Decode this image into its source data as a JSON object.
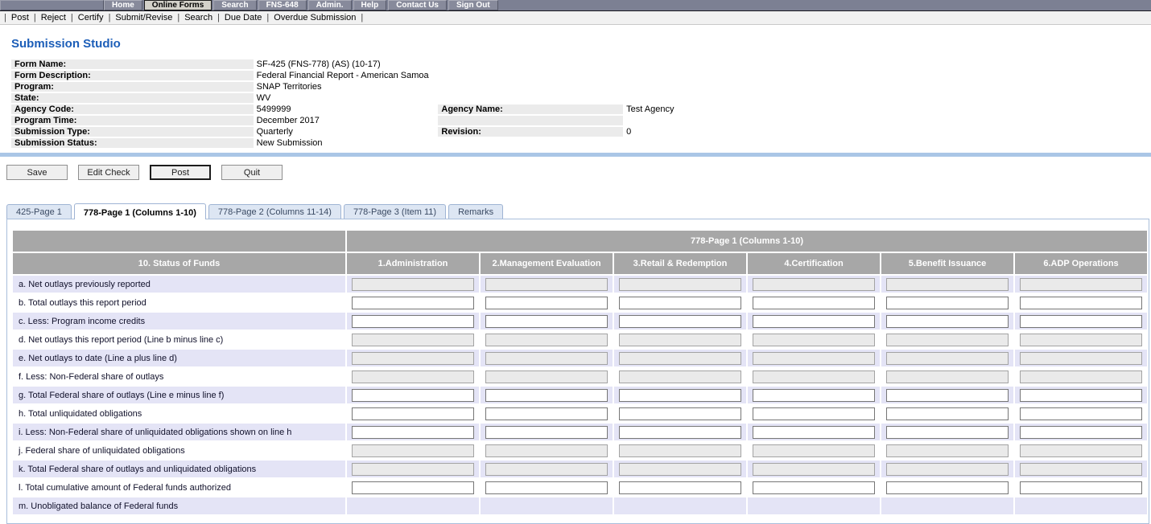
{
  "topnav": {
    "items": [
      {
        "label": "Home",
        "active": false
      },
      {
        "label": "Online Forms",
        "active": true
      },
      {
        "label": "Search",
        "active": false
      },
      {
        "label": "FNS-648",
        "active": false
      },
      {
        "label": "Admin.",
        "active": false
      },
      {
        "label": "Help",
        "active": false
      },
      {
        "label": "Contact Us",
        "active": false
      },
      {
        "label": "Sign Out",
        "active": false
      }
    ]
  },
  "actionbar": {
    "items": [
      "Post",
      "Reject",
      "Certify",
      "Submit/Revise",
      "Search",
      "Due Date",
      "Overdue Submission"
    ],
    "separator": "|"
  },
  "page_title": "Submission Studio",
  "details": {
    "rows": [
      {
        "label": "Form Name:",
        "value": "SF-425 (FNS-778) (AS) (10-17)"
      },
      {
        "label": "Form Description:",
        "value": "Federal Financial Report - American Samoa"
      },
      {
        "label": "Program:",
        "value": "SNAP Territories"
      },
      {
        "label": "State:",
        "value": "WV"
      },
      {
        "label": "Agency Code:",
        "value": "5499999",
        "label2": "Agency Name:",
        "value2": "Test Agency"
      },
      {
        "label": "Program Time:",
        "value": "December 2017",
        "label2": "",
        "value2": ""
      },
      {
        "label": "Submission Type:",
        "value": "Quarterly",
        "label2": "Revision:",
        "value2": "0"
      },
      {
        "label": "Submission Status:",
        "value": "New Submission"
      }
    ]
  },
  "toolbar": {
    "buttons": [
      {
        "label": "Save",
        "default": false
      },
      {
        "label": "Edit Check",
        "default": false
      },
      {
        "label": "Post",
        "default": true
      },
      {
        "label": "Quit",
        "default": false
      }
    ]
  },
  "tabs": [
    {
      "label": "425-Page 1",
      "active": false
    },
    {
      "label": "778-Page 1 (Columns 1-10)",
      "active": true
    },
    {
      "label": "778-Page 2 (Columns 11-14)",
      "active": false
    },
    {
      "label": "778-Page 3 (Item 11)",
      "active": false
    },
    {
      "label": "Remarks",
      "active": false
    }
  ],
  "grid": {
    "group_title": "778-Page 1 (Columns 1-10)",
    "row_header": "10. Status of Funds",
    "columns": [
      "1.Administration",
      "2.Management Evaluation",
      "3.Retail & Redemption",
      "4.Certification",
      "5.Benefit Issuance",
      "6.ADP Operations"
    ],
    "input_value": "",
    "rows": [
      {
        "label": "a. Net outlays previously reported",
        "inputs": "disabled"
      },
      {
        "label": "b. Total outlays this report period",
        "inputs": "enabled"
      },
      {
        "label": "c. Less: Program income credits",
        "inputs": "enabled"
      },
      {
        "label": "d. Net outlays this report period (Line b minus line c)",
        "inputs": "disabled"
      },
      {
        "label": "e. Net outlays to date (Line a plus line d)",
        "inputs": "disabled"
      },
      {
        "label": "f. Less: Non-Federal share of outlays",
        "inputs": "disabled"
      },
      {
        "label": "g. Total Federal share of outlays (Line e minus line f)",
        "inputs": "enabled"
      },
      {
        "label": "h. Total unliquidated obligations",
        "inputs": "enabled"
      },
      {
        "label": "i. Less: Non-Federal share of unliquidated obligations shown on line h",
        "inputs": "enabled"
      },
      {
        "label": "j. Federal share of unliquidated obligations",
        "inputs": "disabled"
      },
      {
        "label": "k. Total Federal share of outlays and unliquidated obligations",
        "inputs": "disabled"
      },
      {
        "label": "l. Total cumulative amount of Federal funds authorized",
        "inputs": "enabled"
      },
      {
        "label": "m. Unobligated balance of Federal funds",
        "inputs": "none"
      }
    ]
  },
  "colors": {
    "topbar": "#7c8093",
    "title_blue": "#1c5eb8",
    "header_gray": "#a7a7a7",
    "row_alt_lavender": "#e4e4f6",
    "blue_bar": "#aac6e6",
    "tab_border": "#9fb4d4",
    "label_cell_gray": "#ebebeb"
  }
}
